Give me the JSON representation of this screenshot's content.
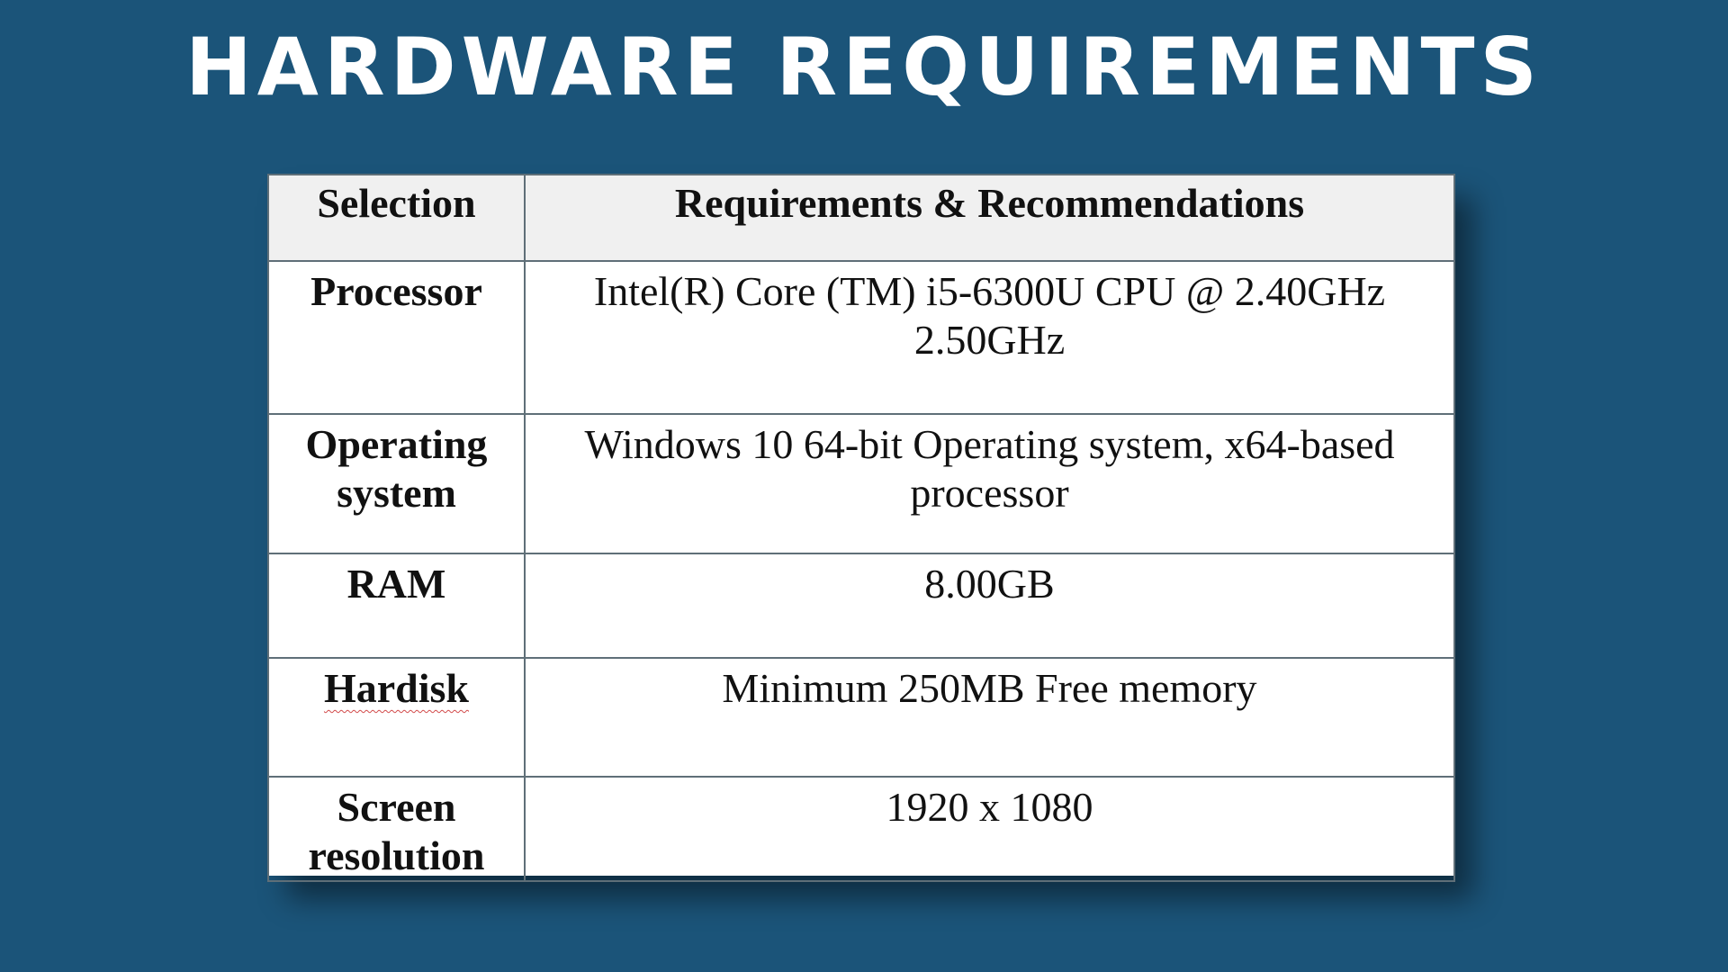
{
  "slide": {
    "title": "HARDWARE REQUIREMENTS",
    "colors": {
      "background": "#1b5479",
      "title": "#ffffff",
      "table_border": "#5f6f78",
      "header_fill": "#f0f0f0",
      "spellcheck_underline": "#d24a4a"
    }
  },
  "table": {
    "headers": [
      "Selection",
      "Requirements & Recommendations"
    ],
    "rows": [
      {
        "label": "Processor",
        "value": "Intel(R) Core (TM) i5-6300U CPU @ 2.40GHz 2.50GHz"
      },
      {
        "label": "Operating system",
        "value": "Windows 10 64-bit Operating system, x64-based processor"
      },
      {
        "label": "RAM",
        "value": "8.00GB"
      },
      {
        "label": "Hardisk",
        "value": "Minimum 250MB Free memory"
      },
      {
        "label": "Screen resolution",
        "value": "1920 x 1080"
      }
    ]
  }
}
